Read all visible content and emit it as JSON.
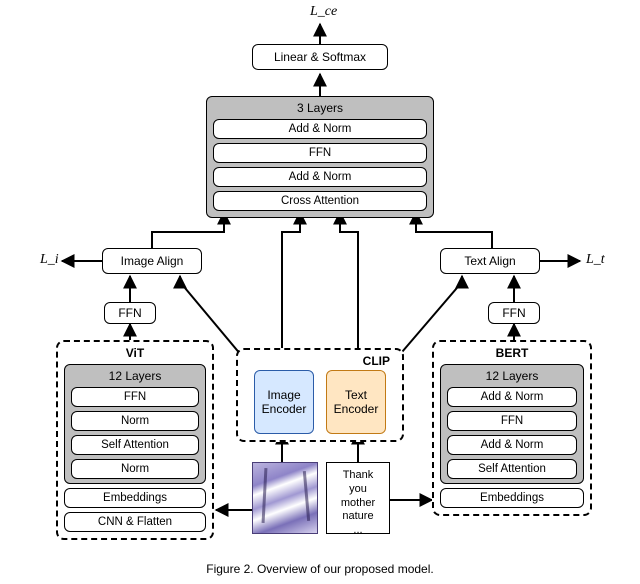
{
  "losses": {
    "ce": "L_ce",
    "i": "L_i",
    "t": "L_t"
  },
  "top": {
    "linear_softmax": "Linear & Softmax"
  },
  "fusion": {
    "title": "3 Layers",
    "layers": [
      "Add & Norm",
      "FFN",
      "Add & Norm",
      "Cross Attention"
    ]
  },
  "align": {
    "image": "Image Align",
    "text": "Text Align",
    "ffn": "FFN"
  },
  "vit": {
    "title": "ViT",
    "panel_title": "12 Layers",
    "layers": [
      "FFN",
      "Norm",
      "Self Attention",
      "Norm"
    ],
    "extras": [
      "Embeddings",
      "CNN & Flatten"
    ]
  },
  "bert": {
    "title": "BERT",
    "panel_title": "12 Layers",
    "layers": [
      "Add & Norm",
      "FFN",
      "Add & Norm",
      "Self Attention"
    ],
    "extras": [
      "Embeddings"
    ]
  },
  "clip": {
    "title": "CLIP",
    "image_encoder": "Image\nEncoder",
    "text_encoder": "Text\nEncoder"
  },
  "inputs": {
    "text": "Thank\nyou\nmother\nnature\n..."
  },
  "caption": "Figure 2. Overview of our proposed model."
}
